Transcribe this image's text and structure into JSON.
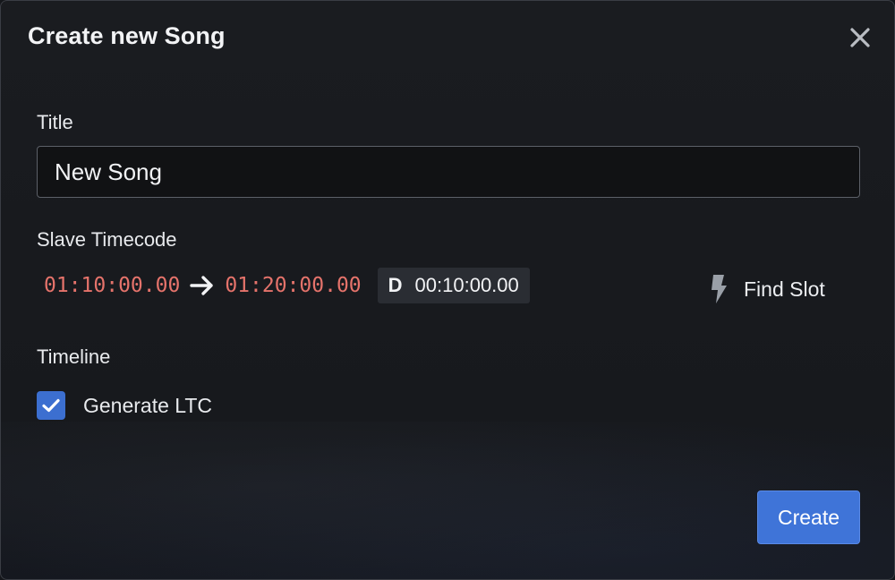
{
  "dialog": {
    "title": "Create new Song"
  },
  "form": {
    "title_label": "Title",
    "title_value": "New Song",
    "timecode_label": "Slave Timecode",
    "start_tc": "01:10:00.00",
    "end_tc": "01:20:00.00",
    "duration_prefix": "D",
    "duration_value": "00:10:00.00",
    "find_slot_label": "Find Slot",
    "timeline_label": "Timeline",
    "generate_ltc_label": "Generate LTC",
    "generate_ltc_checked": true
  },
  "footer": {
    "create_label": "Create"
  },
  "icons": {
    "close": "close-icon",
    "arrow": "arrow-right-icon",
    "find_slot": "lightning-icon",
    "check": "check-icon"
  },
  "colors": {
    "accent": "#3f74d8",
    "timecode": "#e5736b",
    "background": "#17191d"
  }
}
